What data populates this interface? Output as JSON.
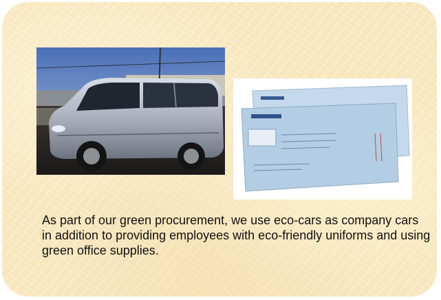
{
  "caption": "As part of our green procurement, we use eco-cars as company cars in addition to providing employees with eco-friendly uniforms and using green office supplies.",
  "images": {
    "car": "silver minivan company eco-car photo",
    "envelopes": "light blue company envelopes photo"
  },
  "colors": {
    "panel_background": "#f8e8c0",
    "text": "#111111",
    "envelope_blue": "#b7d0e6"
  }
}
